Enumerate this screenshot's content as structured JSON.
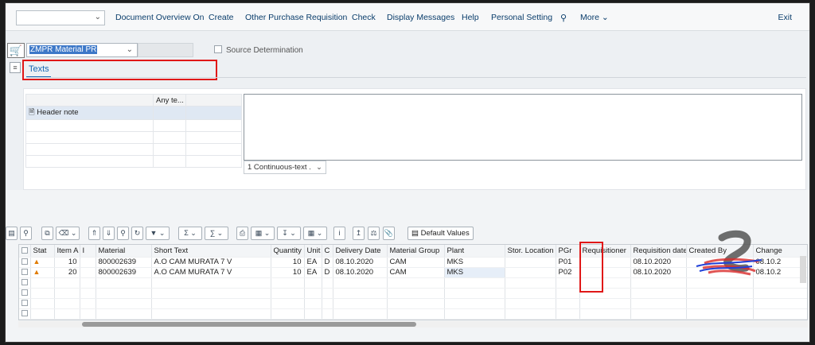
{
  "toolbar": {
    "transaction_select": "",
    "items": [
      "Document Overview On",
      "Create",
      "Other Purchase Requisition",
      "Check",
      "Display Messages",
      "Help",
      "Personal Setting",
      "More"
    ],
    "exit": "Exit"
  },
  "header": {
    "document_type": "ZMPR Material PR",
    "source_determination": "Source Determination",
    "tab_texts": "Texts"
  },
  "texts": {
    "column_header": "Any te...",
    "rows": [
      "Header note",
      "",
      "",
      "",
      ""
    ],
    "format_select": "1 Continuous-text ."
  },
  "items_toolbar": {
    "default_values": "Default Values"
  },
  "grid": {
    "columns": [
      "Stat",
      "Item A",
      "I",
      "Material",
      "Short Text",
      "Quantity",
      "Unit",
      "C",
      "Delivery Date",
      "Material Group",
      "Plant",
      "Stor. Location",
      "PGr",
      "Requisitioner",
      "Requisition date",
      "Created By",
      "Change"
    ],
    "rows": [
      {
        "item": "10",
        "i": "",
        "material": "800002639",
        "short_text": "A.O CAM MURATA 7 V",
        "quantity": "10",
        "unit": "EA",
        "c": "D",
        "delivery_date": "08.10.2020",
        "material_group": "CAM",
        "plant": "MKS",
        "stor_location": "",
        "pgr": "P01",
        "requisitioner": "",
        "req_date": "08.10.2020",
        "created_by": "",
        "change": "08.10.2"
      },
      {
        "item": "20",
        "i": "",
        "material": "800002639",
        "short_text": "A.O CAM MURATA 7 V",
        "quantity": "10",
        "unit": "EA",
        "c": "D",
        "delivery_date": "08.10.2020",
        "material_group": "CAM",
        "plant": "MKS",
        "stor_location": "",
        "pgr": "P02",
        "requisitioner": "",
        "req_date": "08.10.2020",
        "created_by": "",
        "change": "08.10.2"
      }
    ]
  },
  "colors": {
    "link": "#0a3d6b",
    "highlight": "#e01818",
    "tab": "#1668b4"
  },
  "icons": [
    "chevron-down-icon",
    "search-icon",
    "cart-icon",
    "warning-icon"
  ]
}
